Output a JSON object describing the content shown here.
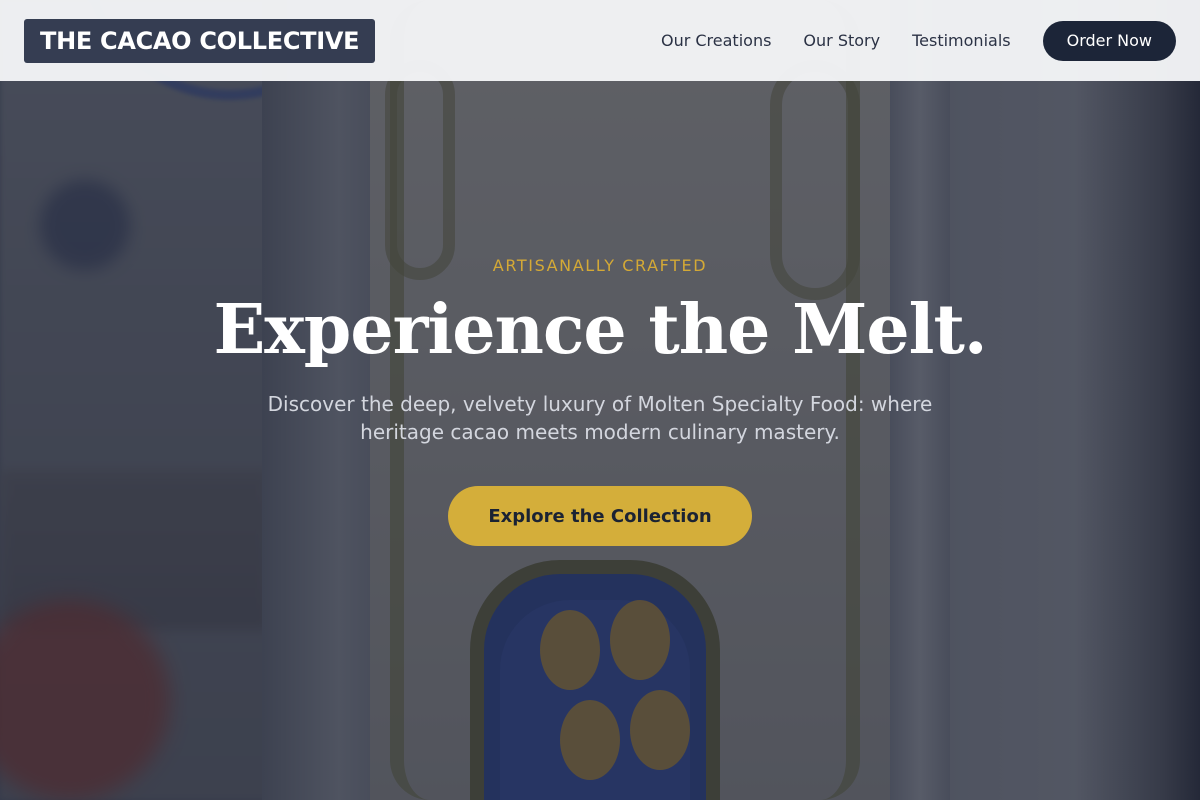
{
  "header": {
    "logo_text": "THE CACAO COLLECTIVE",
    "nav": [
      {
        "label": "Our Creations"
      },
      {
        "label": "Our Story"
      },
      {
        "label": "Testimonials"
      }
    ],
    "cta_label": "Order Now"
  },
  "hero": {
    "eyebrow": "ARTISANALLY CRAFTED",
    "headline": "Experience the Melt.",
    "subtitle": "Discover the deep, velvety luxury of Molten Specialty Food: where heritage cacao meets modern culinary mastery.",
    "button_label": "Explore the Collection",
    "background_image": "blurred shop window with art nouveau tile sign"
  },
  "colors": {
    "accent_gold": "#d4ae3a",
    "navy": "#1c2538",
    "logo_bg": "#353d52"
  }
}
